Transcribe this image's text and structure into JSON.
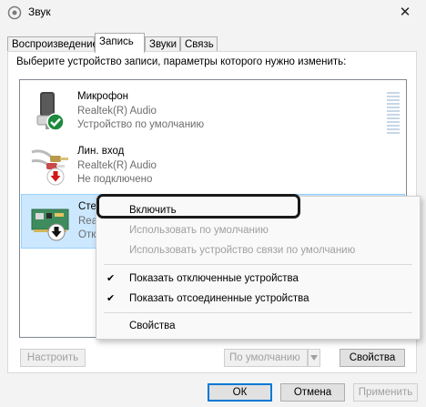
{
  "window": {
    "title": "Звук",
    "close_glyph": "✕"
  },
  "tabs": [
    {
      "label": "Воспроизведение",
      "active": false
    },
    {
      "label": "Запись",
      "active": true
    },
    {
      "label": "Звуки",
      "active": false
    },
    {
      "label": "Связь",
      "active": false
    }
  ],
  "instruction": "Выберите устройство записи, параметры которого нужно изменить:",
  "devices": [
    {
      "name": "Микрофон",
      "driver": "Realtek(R) Audio",
      "status": "Устройство по умолчанию",
      "icon": "microphone-icon",
      "badge": "check-badge-icon"
    },
    {
      "name": "Лин. вход",
      "driver": "Realtek(R) Audio",
      "status": "Не подключено",
      "icon": "line-in-icon",
      "badge": "down-arrow-red-badge-icon"
    },
    {
      "name": "Стерео микшер",
      "driver": "Realtek(R) Audio",
      "status": "Отключено",
      "icon": "sound-card-icon",
      "badge": "down-arrow-black-badge-icon"
    }
  ],
  "context_menu": {
    "enable": "Включить",
    "set_default": "Использовать по умолчанию",
    "set_default_comm": "Использовать устройство связи по умолчанию",
    "show_disabled": "Показать отключенные устройства",
    "show_disconnected": "Показать отсоединенные устройства",
    "properties": "Свойства",
    "check_glyph": "✔"
  },
  "buttons": {
    "configure": "Настроить",
    "set_default": "По умолчанию",
    "properties": "Свойства",
    "ok": "ОК",
    "cancel": "Отмена",
    "apply": "Применить"
  },
  "colors": {
    "selection": "#cce8ff",
    "accent": "#0078d4",
    "check_badge": "#1e8a3c",
    "arrow_badge_red": "#d01818"
  }
}
